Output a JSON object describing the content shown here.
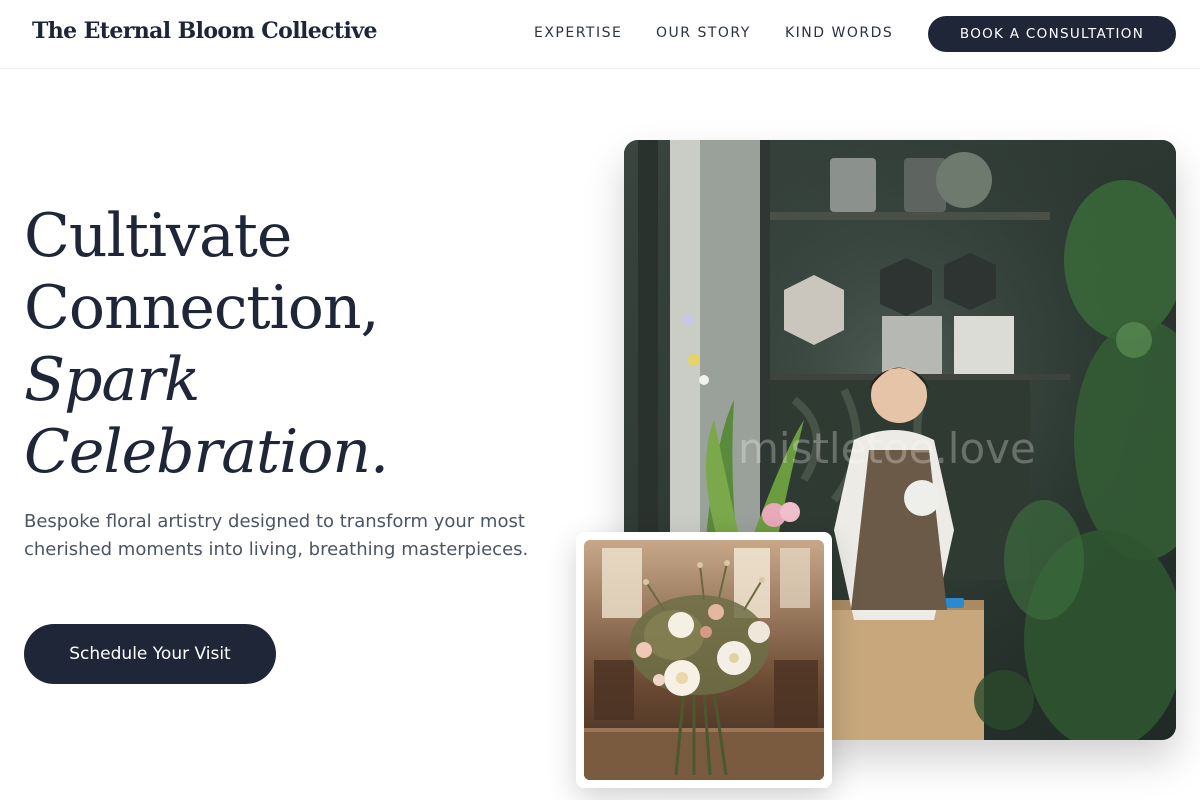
{
  "header": {
    "logo": "The Eternal Bloom Collective",
    "nav": [
      {
        "label": "EXPERTISE"
      },
      {
        "label": "OUR STORY"
      },
      {
        "label": "KIND WORDS"
      }
    ],
    "cta_label": "BOOK A CONSULTATION"
  },
  "hero": {
    "headline_line1": "Cultivate",
    "headline_line2": "Connection,",
    "headline_line3": "Spark",
    "headline_line4": "Celebration.",
    "subtext": "Bespoke floral artistry designed to transform your most cherished moments into living, breathing masterpieces.",
    "cta_label": "Schedule Your Visit"
  },
  "images": {
    "main_watermark": "mistletoe.love"
  },
  "colors": {
    "primary": "#1f2638",
    "text": "#1e293b",
    "muted": "#4b5563"
  }
}
